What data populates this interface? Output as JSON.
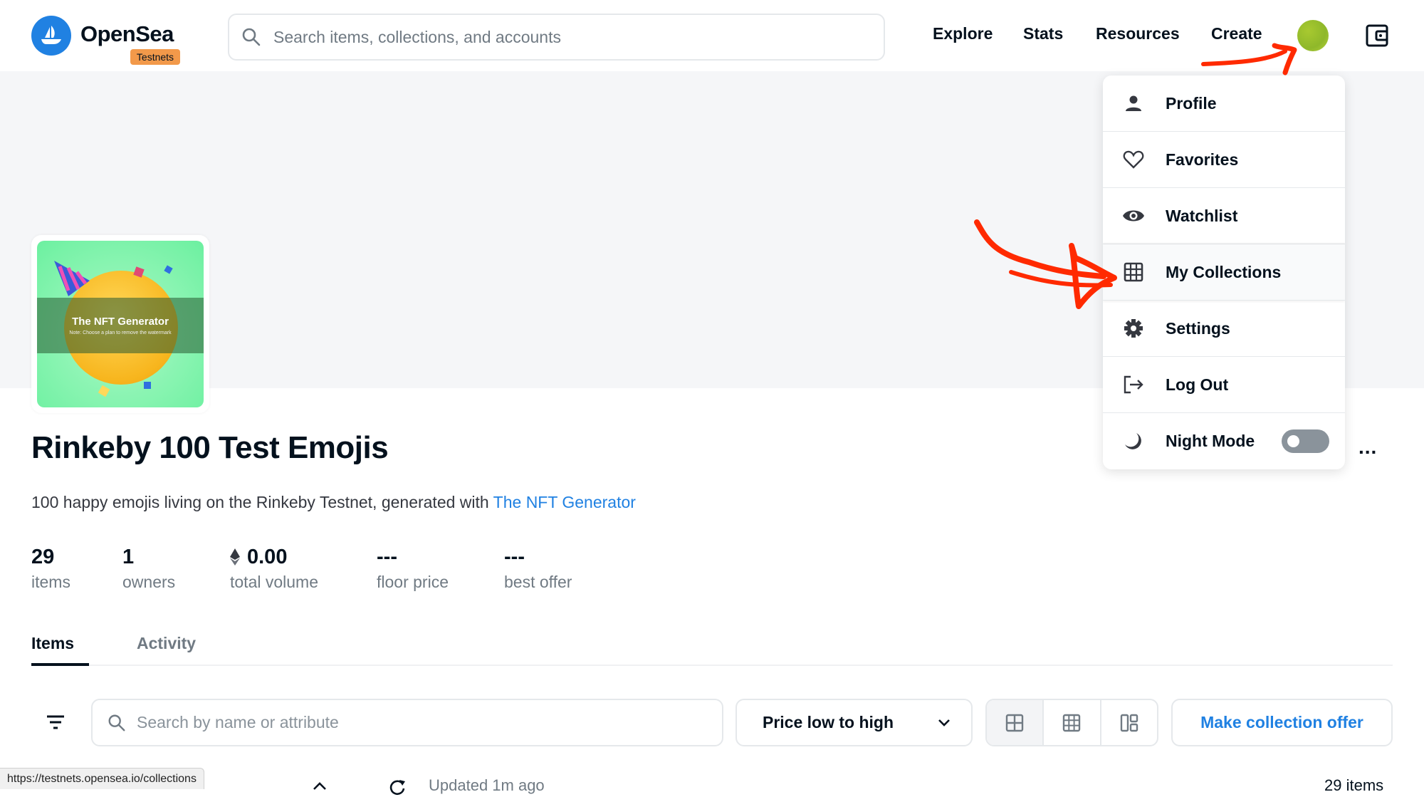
{
  "header": {
    "brand": "OpenSea",
    "badge": "Testnets",
    "search_placeholder": "Search items, collections, and accounts",
    "nav": [
      "Explore",
      "Stats",
      "Resources",
      "Create"
    ],
    "accent_color": "#2081e2"
  },
  "account_menu": {
    "items": [
      {
        "label": "Profile",
        "icon": "person-icon"
      },
      {
        "label": "Favorites",
        "icon": "heart-icon"
      },
      {
        "label": "Watchlist",
        "icon": "eye-icon"
      },
      {
        "label": "My Collections",
        "icon": "grid-icon",
        "highlighted": true
      },
      {
        "label": "Settings",
        "icon": "gear-icon"
      },
      {
        "label": "Log Out",
        "icon": "logout-icon"
      },
      {
        "label": "Night Mode",
        "icon": "moon-icon",
        "toggle": false
      }
    ]
  },
  "collection": {
    "image_watermark_title": "The NFT Generator",
    "image_watermark_note": "Note: Choose a plan to remove the watermark",
    "title": "Rinkeby 100 Test Emojis",
    "description": "100 happy emojis living on the Rinkeby Testnet, generated with ",
    "description_link": "The NFT Generator",
    "stats": [
      {
        "value": "29",
        "label": "items"
      },
      {
        "value": "1",
        "label": "owners"
      },
      {
        "value": "0.00",
        "label": "total volume",
        "currency_icon": "eth-icon"
      },
      {
        "value": "---",
        "label": "floor price"
      },
      {
        "value": "---",
        "label": "best offer"
      }
    ],
    "more_label": "..."
  },
  "tabs": [
    {
      "label": "Items",
      "active": true
    },
    {
      "label": "Activity",
      "active": false
    }
  ],
  "toolbar": {
    "search_placeholder": "Search by name or attribute",
    "sort_selected": "Price low to high",
    "view_modes": [
      "large-grid",
      "small-grid",
      "mosaic"
    ],
    "active_view": "large-grid",
    "offer_button": "Make collection offer"
  },
  "subrow": {
    "updated": "Updated 1m ago",
    "count": "29 items"
  },
  "status_bar": {
    "url": "https://testnets.opensea.io/collections"
  }
}
